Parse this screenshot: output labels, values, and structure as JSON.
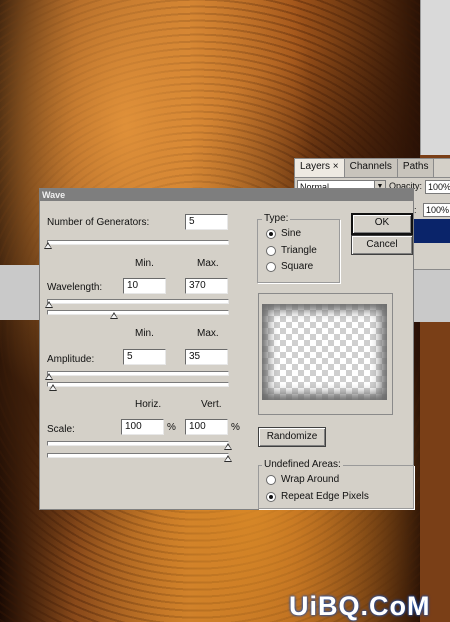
{
  "layers_panel": {
    "tabs": [
      {
        "label": "Layers",
        "close": "×"
      },
      {
        "label": "Channels"
      },
      {
        "label": "Paths"
      }
    ],
    "blend_mode": "Normal",
    "opacity_label": "Opacity:",
    "opacity_value": "100%",
    "fill_label": "ill:",
    "fill_value": "100%"
  },
  "dialog": {
    "title": "Wave",
    "generators_label": "Number of Generators:",
    "generators_value": "5",
    "min_header": "Min.",
    "max_header": "Max.",
    "wavelength_label": "Wavelength:",
    "wavelength_min": "10",
    "wavelength_max": "370",
    "amplitude_label": "Amplitude:",
    "amplitude_min": "5",
    "amplitude_max": "35",
    "horiz_header": "Horiz.",
    "vert_header": "Vert.",
    "scale_label": "Scale:",
    "scale_horiz": "100",
    "scale_vert": "100",
    "percent": "%",
    "type_title": "Type:",
    "types": [
      {
        "label": "Sine",
        "selected": true
      },
      {
        "label": "Triangle",
        "selected": false
      },
      {
        "label": "Square",
        "selected": false
      }
    ],
    "ok_label": "OK",
    "cancel_label": "Cancel",
    "randomize_label": "Randomize",
    "undefined_title": "Undefined Areas:",
    "undefined_options": [
      {
        "label": "Wrap Around",
        "selected": false
      },
      {
        "label": "Repeat Edge Pixels",
        "selected": true
      }
    ]
  },
  "watermark": "UiBQ.CoM",
  "colors": {
    "dialog_bg": "#d4d0c8",
    "titlebar": "#7e7e7e",
    "selection": "#0a246a"
  }
}
